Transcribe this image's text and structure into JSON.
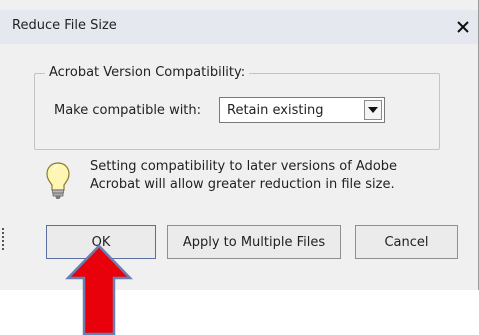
{
  "dialog": {
    "title": "Reduce File Size",
    "close_icon": "close-x-icon"
  },
  "compatibility": {
    "group_title": "Acrobat Version Compatibility:",
    "label": "Make compatible with:",
    "selected": "Retain existing"
  },
  "info": {
    "icon": "lightbulb-icon",
    "text": "Setting compatibility to later versions of Adobe Acrobat will allow greater reduction in file size."
  },
  "buttons": {
    "ok": "OK",
    "apply": "Apply to Multiple Files",
    "cancel": "Cancel"
  },
  "annotation": {
    "arrow_icon": "red-arrow-up-icon",
    "arrow_color": "#e8000b"
  },
  "colors": {
    "titlebar": "#e5e9ef",
    "dialog_bg": "#f0f0f0"
  }
}
